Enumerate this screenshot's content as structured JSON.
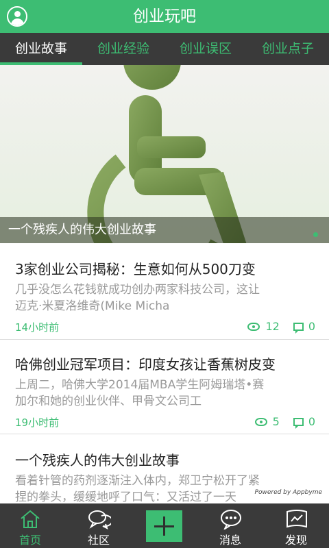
{
  "app": {
    "title": "创业玩吧"
  },
  "tabs": [
    {
      "label": "创业故事",
      "active": true
    },
    {
      "label": "创业经验",
      "active": false
    },
    {
      "label": "创业误区",
      "active": false
    },
    {
      "label": "创业点子",
      "active": false
    }
  ],
  "banner": {
    "caption": "一个残疾人的伟大创业故事",
    "icon": "wheelchair-icon"
  },
  "articles": [
    {
      "title": "3家创业公司揭秘：生意如何从500刀变",
      "summary_line1": "几乎没怎么花钱就成功创办两家科技公司，这让",
      "summary_line2": "迈克·米夏洛维奇(Mike Micha",
      "time": "14小时前",
      "views": "12",
      "comments": "0"
    },
    {
      "title": "哈佛创业冠军项目：印度女孩让香蕉树皮变",
      "summary_line1": "上周二，哈佛大学2014届MBA学生阿姆瑞塔•赛",
      "summary_line2": "加尔和她的创业伙伴、甲骨文公司工",
      "time": "19小时前",
      "views": "5",
      "comments": "0"
    },
    {
      "title": "一个残疾人的伟大创业故事",
      "summary_line1": "看着针管的药剂逐渐注入体内，郑卫宁松开了紧",
      "summary_line2": "捏的拳头，缓缓地呼了口气：又活过了一天"
    }
  ],
  "powered_by": "Powered by Appbyme",
  "bottom_nav": [
    {
      "label": "首页",
      "icon": "home-icon",
      "active": true
    },
    {
      "label": "社区",
      "icon": "chat-bubbles-icon",
      "active": false
    },
    {
      "label": "",
      "icon": "plus-icon",
      "active": false
    },
    {
      "label": "消息",
      "icon": "message-icon",
      "active": false
    },
    {
      "label": "发现",
      "icon": "discover-icon",
      "active": false
    }
  ],
  "colors": {
    "accent": "#3dbd73",
    "bar_dark": "#3a3a3a"
  }
}
